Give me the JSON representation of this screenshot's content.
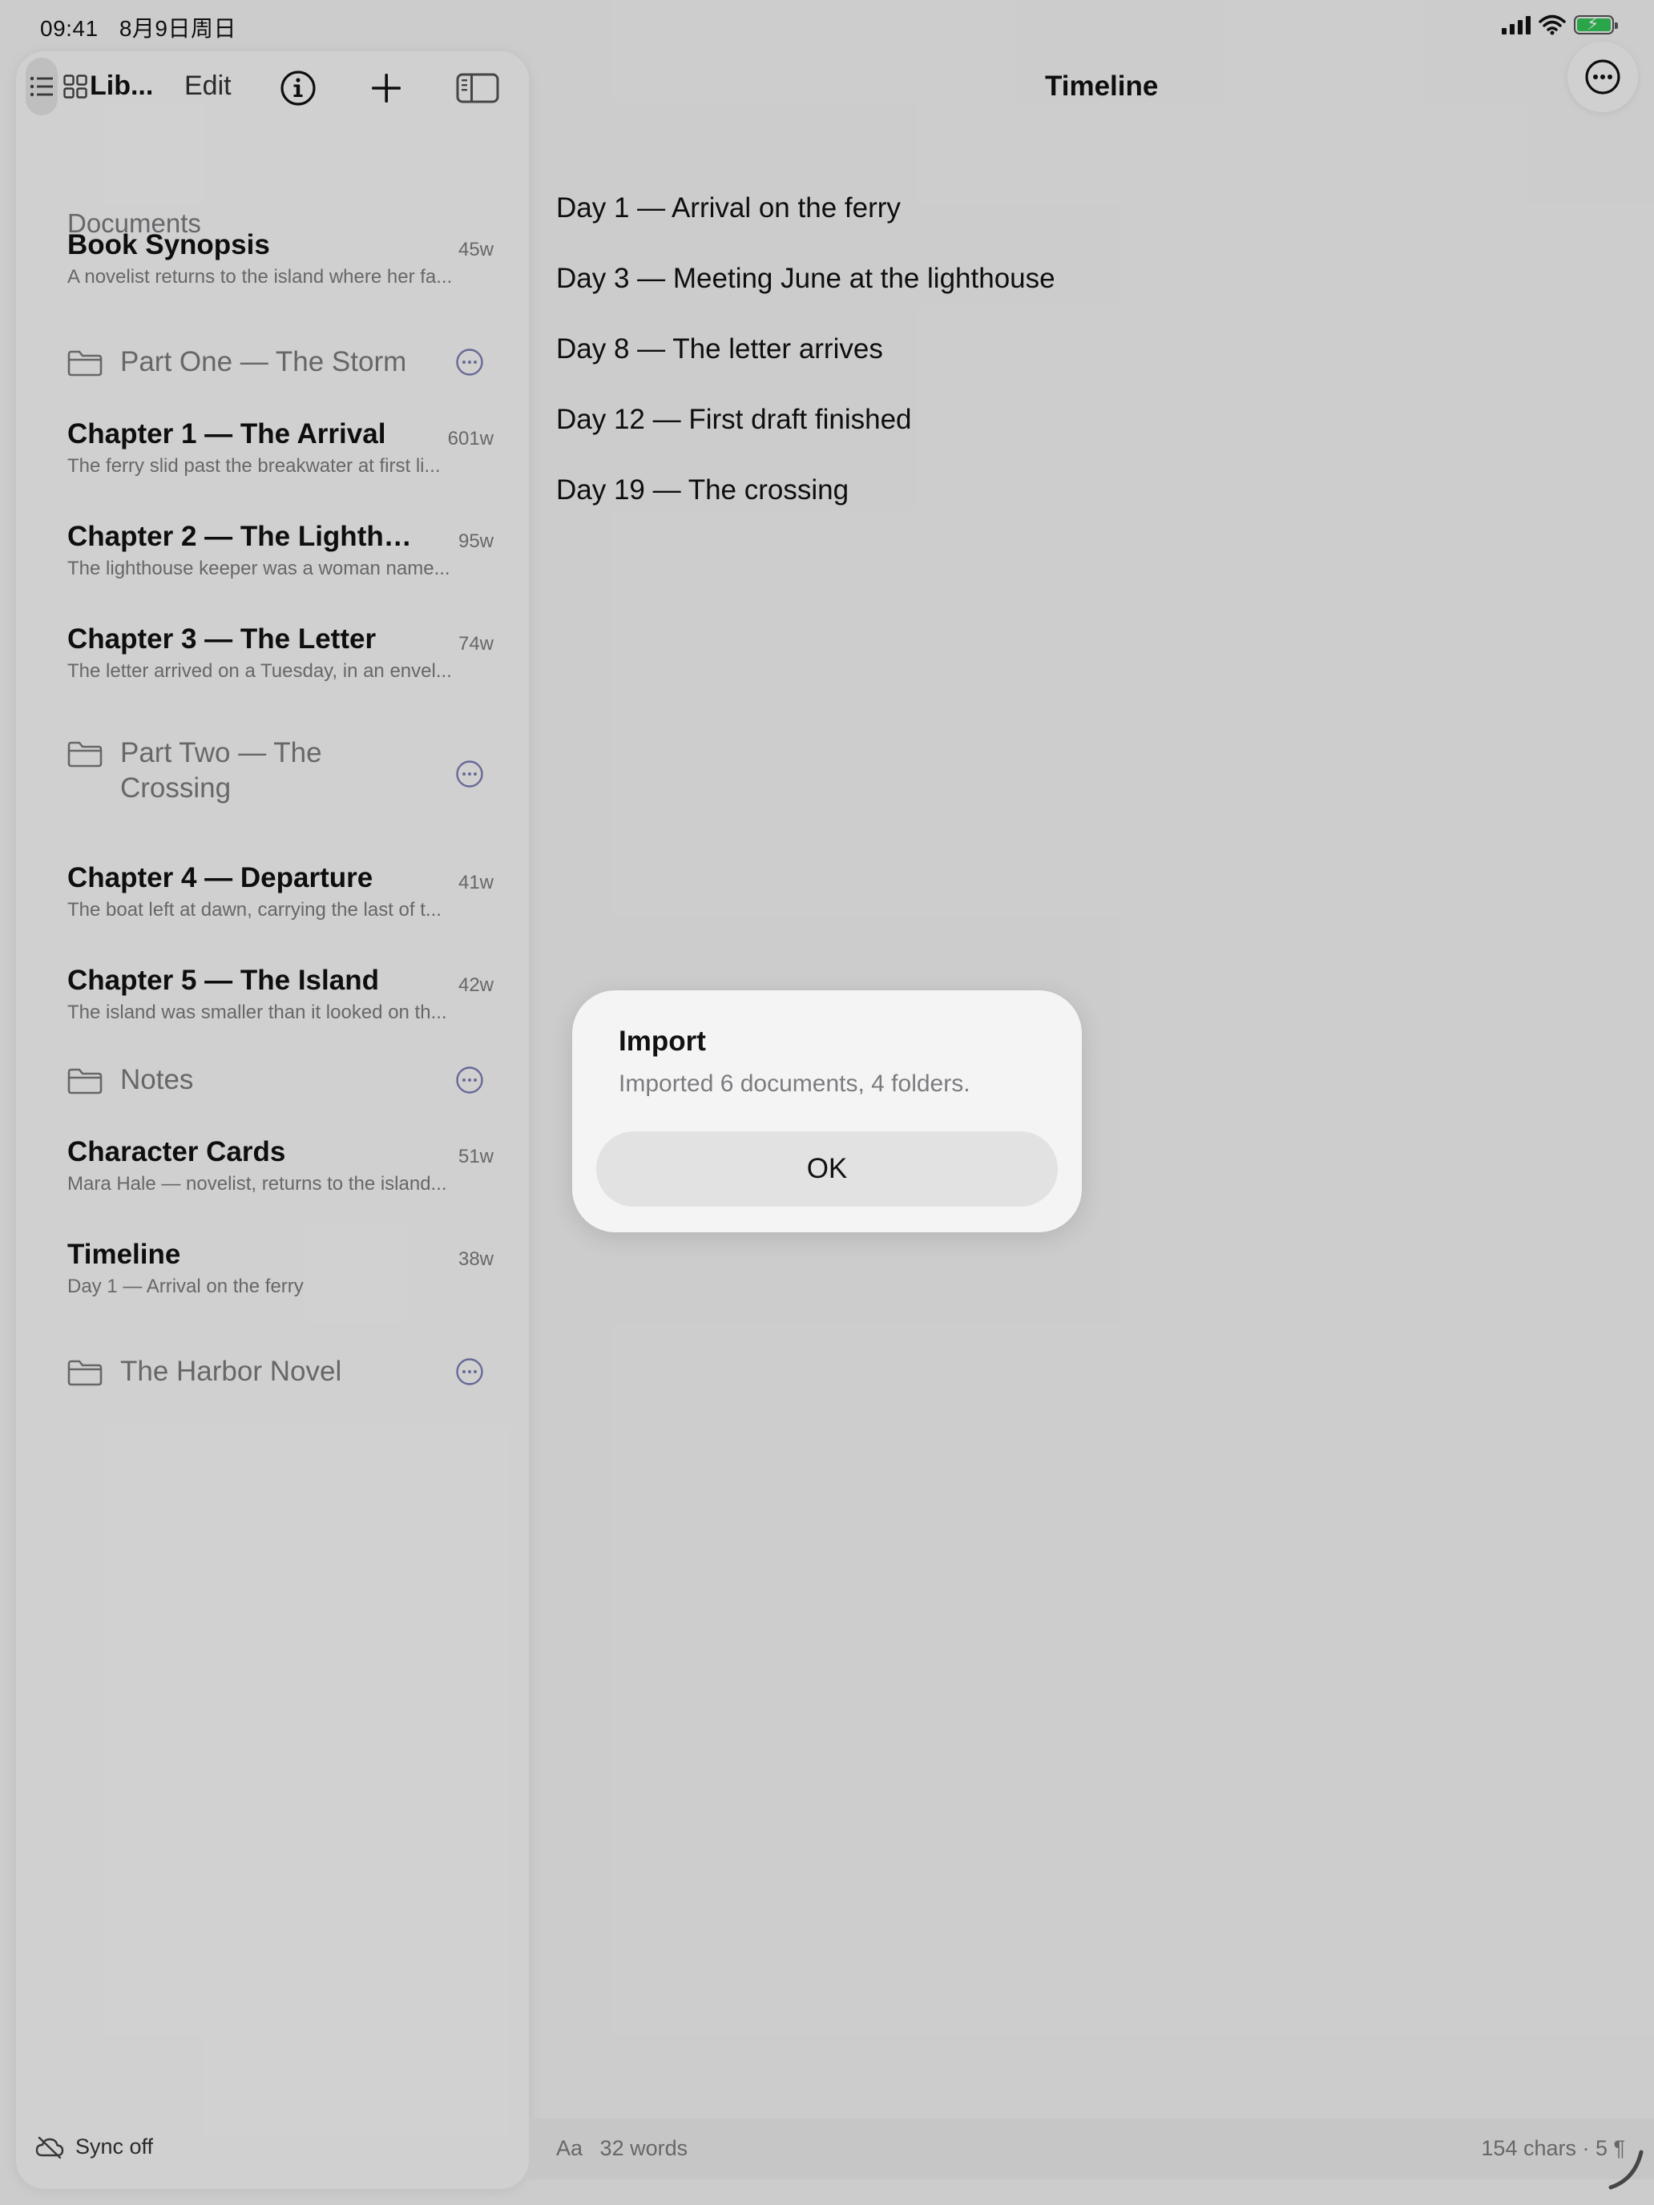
{
  "status_bar": {
    "time": "09:41",
    "date": "8月9日周日",
    "battery_color": "#34c759"
  },
  "sidebar": {
    "title": "Lib...",
    "edit_label": "Edit",
    "section_header": "Documents",
    "icons": {
      "list": "list-icon",
      "grid": "grid-icon",
      "info": "info-icon",
      "add": "plus-icon",
      "toggle": "sidebar-toggle-icon"
    },
    "items": [
      {
        "type": "document",
        "title": "Book Synopsis",
        "count": "45w",
        "preview": "A novelist returns to the island where her fa..."
      },
      {
        "type": "folder",
        "title": "Part One — The Storm"
      },
      {
        "type": "document",
        "title": "Chapter 1 — The Arrival",
        "count": "601w",
        "preview": "The ferry slid past the breakwater at first li..."
      },
      {
        "type": "document",
        "title": "Chapter 2 — The Lighthou...",
        "count": "95w",
        "preview": "The lighthouse keeper was a woman name..."
      },
      {
        "type": "document",
        "title": "Chapter 3 — The Letter",
        "count": "74w",
        "preview": "The letter arrived on a Tuesday, in an envel..."
      },
      {
        "type": "folder",
        "title": "Part Two — The Crossing"
      },
      {
        "type": "document",
        "title": "Chapter 4 — Departure",
        "count": "41w",
        "preview": "The boat left at dawn, carrying the last of t..."
      },
      {
        "type": "document",
        "title": "Chapter 5 — The Island",
        "count": "42w",
        "preview": "The island was smaller than it looked on th..."
      },
      {
        "type": "folder",
        "title": "Notes"
      },
      {
        "type": "document",
        "title": "Character Cards",
        "count": "51w",
        "preview": "Mara Hale — novelist, returns to the island..."
      },
      {
        "type": "document",
        "title": "Timeline",
        "count": "38w",
        "preview": "Day 1 — Arrival on the ferry"
      },
      {
        "type": "folder",
        "title": "The Harbor Novel"
      }
    ],
    "sync_label": "Sync off"
  },
  "main": {
    "title": "Timeline",
    "lines": [
      "Day 1 — Arrival on the ferry",
      "Day 3 — Meeting June at the lighthouse",
      "Day 8 — The letter arrives",
      "Day 12 — First draft finished",
      "Day 19 — The crossing"
    ],
    "bottom_bar": {
      "font_label": "Aa",
      "word_count": "32 words",
      "char_stats": "154 chars · 5 ¶"
    }
  },
  "alert": {
    "title": "Import",
    "message": "Imported 6 documents, 4 folders.",
    "ok_label": "OK"
  },
  "colors": {
    "accent_more_icon": "#7d7fb6",
    "secondary_text": "#7c7c80"
  }
}
